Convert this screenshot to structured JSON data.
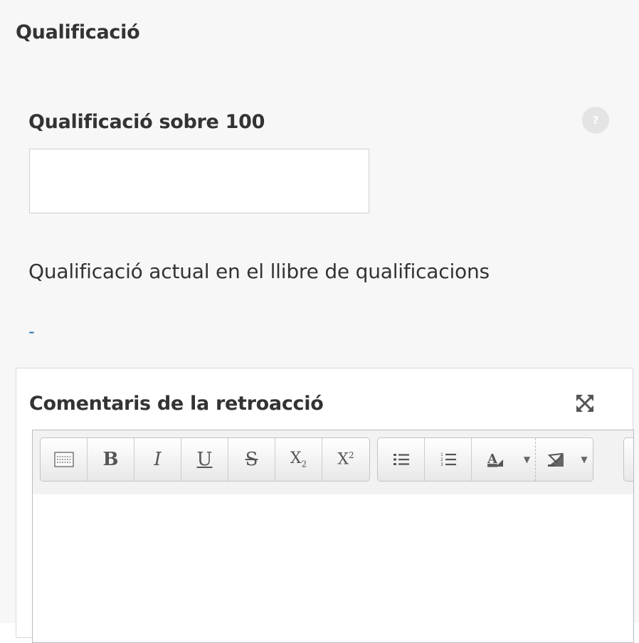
{
  "section": {
    "title": "Qualificació"
  },
  "grade": {
    "label": "Qualificació sobre 100",
    "value": "",
    "placeholder": ""
  },
  "gradebook": {
    "label": "Qualificació actual en el llibre de qualificacions",
    "value": "-"
  },
  "feedback": {
    "title": "Comentaris de la retroacció",
    "toolbar": {
      "toggle": "toolbar-toggle",
      "bold": "B",
      "italic": "I",
      "underline": "U",
      "strike": "S",
      "subscript": "X",
      "subscript_mark": "2",
      "superscript": "X",
      "superscript_mark": "2",
      "font_color_letter": "A",
      "dropdown_glyph": "▼"
    },
    "content": ""
  },
  "icons": {
    "help": "help-icon",
    "expand": "expand-icon",
    "bullets": "bullet-list-icon",
    "numbered": "numbered-list-icon",
    "font_color": "font-color-icon",
    "highlight": "highlight-icon",
    "kitchen_sink": "show-more-buttons-icon"
  },
  "colors": {
    "link": "#1b6fb6",
    "panel_bg": "#f7f7f7",
    "help_bg": "#e4e4e4"
  }
}
